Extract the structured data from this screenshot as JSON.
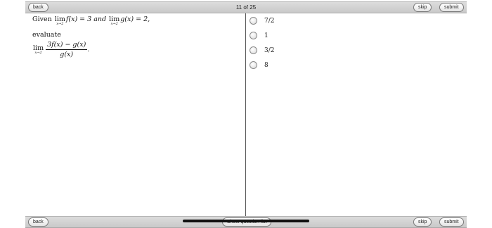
{
  "top_bar": {
    "back_label": "back",
    "counter": "11 of 25",
    "skip_label": "skip",
    "submit_label": "submit"
  },
  "bottom_bar": {
    "back_label": "back",
    "show_list_label": "Show question list",
    "skip_label": "skip",
    "submit_label": "submit"
  },
  "question": {
    "given": "Given",
    "lim": "lim",
    "lim_sub": "x→2",
    "f_expr": "f(x) = 3 and",
    "g_expr": "g(x) = 2,",
    "evaluate": "evaluate",
    "numerator": "3f(x) − g(x)",
    "denominator": "g(x)",
    "end": "."
  },
  "answers": [
    {
      "label": "7/2"
    },
    {
      "label": "1"
    },
    {
      "label": "3/2"
    },
    {
      "label": "8"
    }
  ]
}
